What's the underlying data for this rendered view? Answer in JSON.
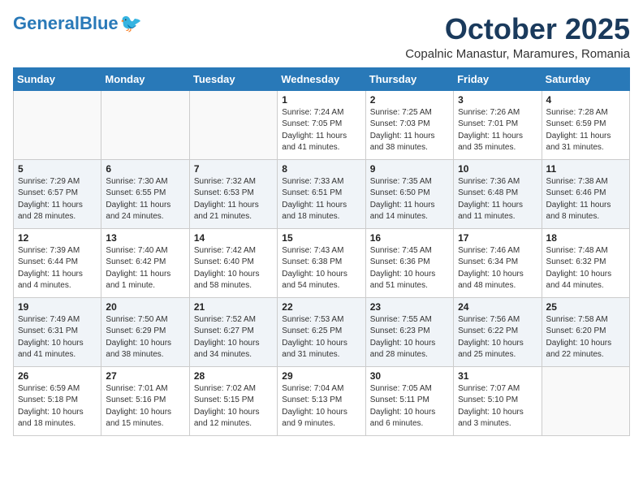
{
  "header": {
    "logo_general": "General",
    "logo_blue": "Blue",
    "month": "October 2025",
    "location": "Copalnic Manastur, Maramures, Romania"
  },
  "days_of_week": [
    "Sunday",
    "Monday",
    "Tuesday",
    "Wednesday",
    "Thursday",
    "Friday",
    "Saturday"
  ],
  "weeks": [
    [
      {
        "day": "",
        "detail": ""
      },
      {
        "day": "",
        "detail": ""
      },
      {
        "day": "",
        "detail": ""
      },
      {
        "day": "1",
        "detail": "Sunrise: 7:24 AM\nSunset: 7:05 PM\nDaylight: 11 hours\nand 41 minutes."
      },
      {
        "day": "2",
        "detail": "Sunrise: 7:25 AM\nSunset: 7:03 PM\nDaylight: 11 hours\nand 38 minutes."
      },
      {
        "day": "3",
        "detail": "Sunrise: 7:26 AM\nSunset: 7:01 PM\nDaylight: 11 hours\nand 35 minutes."
      },
      {
        "day": "4",
        "detail": "Sunrise: 7:28 AM\nSunset: 6:59 PM\nDaylight: 11 hours\nand 31 minutes."
      }
    ],
    [
      {
        "day": "5",
        "detail": "Sunrise: 7:29 AM\nSunset: 6:57 PM\nDaylight: 11 hours\nand 28 minutes."
      },
      {
        "day": "6",
        "detail": "Sunrise: 7:30 AM\nSunset: 6:55 PM\nDaylight: 11 hours\nand 24 minutes."
      },
      {
        "day": "7",
        "detail": "Sunrise: 7:32 AM\nSunset: 6:53 PM\nDaylight: 11 hours\nand 21 minutes."
      },
      {
        "day": "8",
        "detail": "Sunrise: 7:33 AM\nSunset: 6:51 PM\nDaylight: 11 hours\nand 18 minutes."
      },
      {
        "day": "9",
        "detail": "Sunrise: 7:35 AM\nSunset: 6:50 PM\nDaylight: 11 hours\nand 14 minutes."
      },
      {
        "day": "10",
        "detail": "Sunrise: 7:36 AM\nSunset: 6:48 PM\nDaylight: 11 hours\nand 11 minutes."
      },
      {
        "day": "11",
        "detail": "Sunrise: 7:38 AM\nSunset: 6:46 PM\nDaylight: 11 hours\nand 8 minutes."
      }
    ],
    [
      {
        "day": "12",
        "detail": "Sunrise: 7:39 AM\nSunset: 6:44 PM\nDaylight: 11 hours\nand 4 minutes."
      },
      {
        "day": "13",
        "detail": "Sunrise: 7:40 AM\nSunset: 6:42 PM\nDaylight: 11 hours\nand 1 minute."
      },
      {
        "day": "14",
        "detail": "Sunrise: 7:42 AM\nSunset: 6:40 PM\nDaylight: 10 hours\nand 58 minutes."
      },
      {
        "day": "15",
        "detail": "Sunrise: 7:43 AM\nSunset: 6:38 PM\nDaylight: 10 hours\nand 54 minutes."
      },
      {
        "day": "16",
        "detail": "Sunrise: 7:45 AM\nSunset: 6:36 PM\nDaylight: 10 hours\nand 51 minutes."
      },
      {
        "day": "17",
        "detail": "Sunrise: 7:46 AM\nSunset: 6:34 PM\nDaylight: 10 hours\nand 48 minutes."
      },
      {
        "day": "18",
        "detail": "Sunrise: 7:48 AM\nSunset: 6:32 PM\nDaylight: 10 hours\nand 44 minutes."
      }
    ],
    [
      {
        "day": "19",
        "detail": "Sunrise: 7:49 AM\nSunset: 6:31 PM\nDaylight: 10 hours\nand 41 minutes."
      },
      {
        "day": "20",
        "detail": "Sunrise: 7:50 AM\nSunset: 6:29 PM\nDaylight: 10 hours\nand 38 minutes."
      },
      {
        "day": "21",
        "detail": "Sunrise: 7:52 AM\nSunset: 6:27 PM\nDaylight: 10 hours\nand 34 minutes."
      },
      {
        "day": "22",
        "detail": "Sunrise: 7:53 AM\nSunset: 6:25 PM\nDaylight: 10 hours\nand 31 minutes."
      },
      {
        "day": "23",
        "detail": "Sunrise: 7:55 AM\nSunset: 6:23 PM\nDaylight: 10 hours\nand 28 minutes."
      },
      {
        "day": "24",
        "detail": "Sunrise: 7:56 AM\nSunset: 6:22 PM\nDaylight: 10 hours\nand 25 minutes."
      },
      {
        "day": "25",
        "detail": "Sunrise: 7:58 AM\nSunset: 6:20 PM\nDaylight: 10 hours\nand 22 minutes."
      }
    ],
    [
      {
        "day": "26",
        "detail": "Sunrise: 6:59 AM\nSunset: 5:18 PM\nDaylight: 10 hours\nand 18 minutes."
      },
      {
        "day": "27",
        "detail": "Sunrise: 7:01 AM\nSunset: 5:16 PM\nDaylight: 10 hours\nand 15 minutes."
      },
      {
        "day": "28",
        "detail": "Sunrise: 7:02 AM\nSunset: 5:15 PM\nDaylight: 10 hours\nand 12 minutes."
      },
      {
        "day": "29",
        "detail": "Sunrise: 7:04 AM\nSunset: 5:13 PM\nDaylight: 10 hours\nand 9 minutes."
      },
      {
        "day": "30",
        "detail": "Sunrise: 7:05 AM\nSunset: 5:11 PM\nDaylight: 10 hours\nand 6 minutes."
      },
      {
        "day": "31",
        "detail": "Sunrise: 7:07 AM\nSunset: 5:10 PM\nDaylight: 10 hours\nand 3 minutes."
      },
      {
        "day": "",
        "detail": ""
      }
    ]
  ]
}
